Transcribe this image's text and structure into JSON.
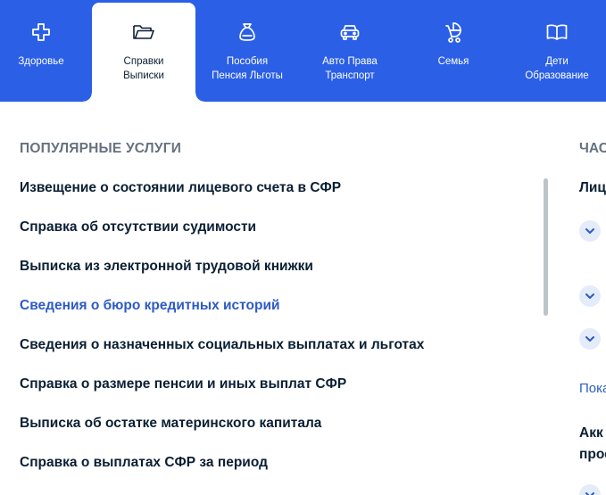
{
  "nav": {
    "tabs": [
      {
        "label": "Здоровье",
        "icon": "medical-cross-icon"
      },
      {
        "label": "Справки\nВыписки",
        "icon": "folder-icon",
        "active": true
      },
      {
        "label": "Пособия\nПенсия Льготы",
        "icon": "money-bag-icon"
      },
      {
        "label": "Авто Права\nТранспорт",
        "icon": "car-icon"
      },
      {
        "label": "Семья",
        "icon": "stroller-icon"
      },
      {
        "label": "Дети\nОбразование",
        "icon": "book-icon"
      }
    ]
  },
  "popular": {
    "title": "ПОПУЛЯРНЫЕ УСЛУГИ",
    "items": [
      "Извещение о состоянии лицевого счета в СФР",
      "Справка об отсутствии судимости",
      "Выписка из электронной трудовой книжки",
      "Сведения о бюро кредитных историй",
      "Сведения о назначенных социальных выплатах и льготах",
      "Справка о размере пенсии и иных выплат СФР",
      "Выписка об остатке материнского капитала",
      "Справка о выплатах СФР за период"
    ]
  },
  "faq": {
    "title_partial": "ЧАС",
    "subtitle_partial": "Лиц",
    "link_partial": "Пока",
    "text_partial": "Акк\nпрос"
  },
  "colors": {
    "header_bg": "#2b5fe6",
    "link": "#2d5bc4",
    "section_title": "#66727f"
  }
}
